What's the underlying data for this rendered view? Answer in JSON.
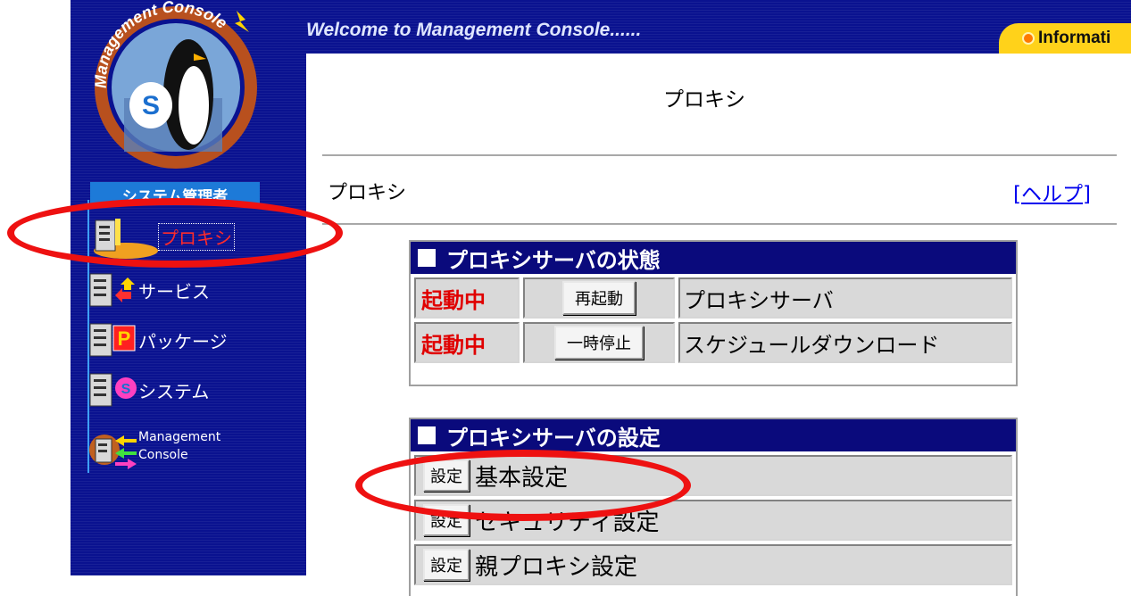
{
  "header": {
    "welcome": "Welcome to Management Console......",
    "info_tab": "Informati"
  },
  "sidebar": {
    "logo": {
      "arc_text": "Management Console",
      "badge": "S"
    },
    "role": "システム管理者",
    "items": [
      {
        "label": "プロキシ",
        "icon": "proxy-server-icon",
        "selected": true
      },
      {
        "label": "サービス",
        "icon": "service-icon"
      },
      {
        "label": "パッケージ",
        "icon": "package-icon",
        "badge": "P"
      },
      {
        "label": "システム",
        "icon": "system-icon",
        "badge": "S"
      },
      {
        "label": "Management\nConsole",
        "icon": "management-console-icon"
      }
    ]
  },
  "main": {
    "page_title": "プロキシ",
    "section_title": "プロキシ",
    "help_link": "[ヘルプ]",
    "status_panel": {
      "title": "プロキシサーバの状態",
      "rows": [
        {
          "status": "起動中",
          "button": "再起動",
          "name": "プロキシサーバ"
        },
        {
          "status": "起動中",
          "button": "一時停止",
          "name": "スケジュールダウンロード"
        }
      ]
    },
    "settings_panel": {
      "title": "プロキシサーバの設定",
      "rows": [
        {
          "button": "設定",
          "name": "基本設定"
        },
        {
          "button": "設定",
          "name": "セキュリティ設定"
        },
        {
          "button": "設定",
          "name": "親プロキシ設定"
        }
      ]
    }
  },
  "colors": {
    "sidebar_bg": "#0a1290",
    "panel_header": "#0a0a7c",
    "status_red": "#e00000",
    "annotation_red": "#ee1111",
    "info_tab": "#ffd21a"
  }
}
